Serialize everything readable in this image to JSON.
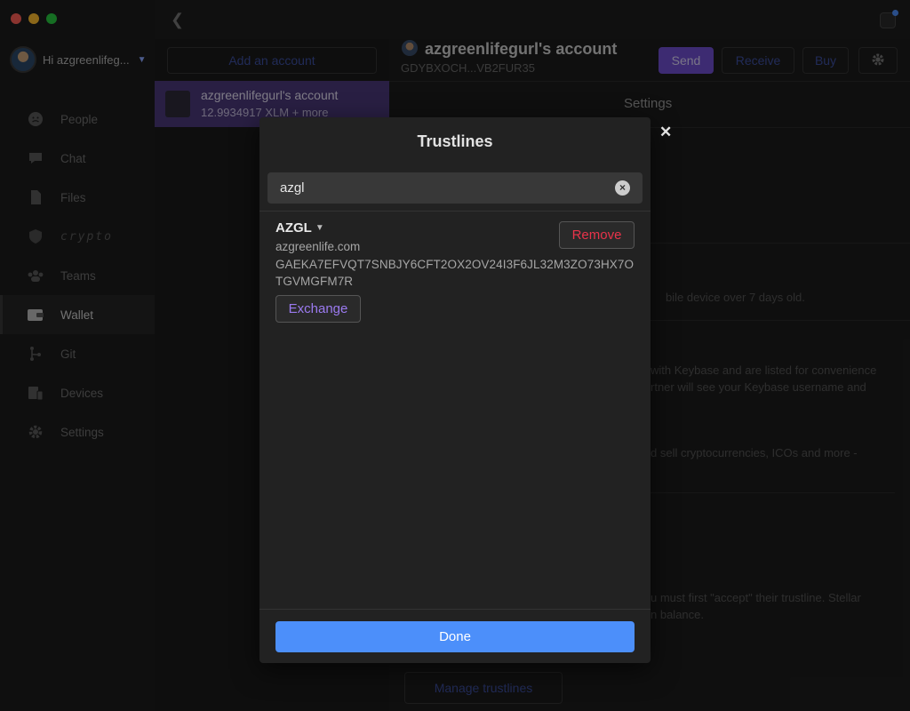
{
  "sidebar": {
    "greeting": "Hi azgreenlifeg...",
    "items": [
      {
        "label": "People",
        "icon": "people-icon"
      },
      {
        "label": "Chat",
        "icon": "chat-icon"
      },
      {
        "label": "Files",
        "icon": "files-icon"
      },
      {
        "label": "crypto",
        "icon": "crypto-shield-icon"
      },
      {
        "label": "Teams",
        "icon": "teams-icon"
      },
      {
        "label": "Wallet",
        "icon": "wallet-icon",
        "active": true
      },
      {
        "label": "Git",
        "icon": "git-icon"
      },
      {
        "label": "Devices",
        "icon": "devices-icon"
      },
      {
        "label": "Settings",
        "icon": "gear-icon"
      }
    ]
  },
  "accounts": {
    "add_label": "Add an account",
    "selected": {
      "name": "azgreenlifegurl's account",
      "balance": "12.9934917 XLM + more"
    }
  },
  "main": {
    "title": "azgreenlifegurl's account",
    "address": "GDYBXOCH...VB2FUR35",
    "buttons": {
      "send": "Send",
      "receive": "Receive",
      "buy": "Buy"
    },
    "settings_title": "Settings",
    "bg_texts": {
      "t1": "bile device over 7 days old.",
      "t2": "with Keybase and are listed for convenience",
      "t3": "rtner will see your Keybase username and",
      "t4": "d sell cryptocurrencies, ICOs and more -",
      "t5": "u must first \"accept\" their trustline. Stellar",
      "t6": "n balance."
    },
    "manage_label": "Manage trustlines"
  },
  "modal": {
    "title": "Trustlines",
    "search_value": "azgl",
    "asset": {
      "code": "AZGL",
      "domain": "azgreenlife.com",
      "issuer": "GAEKA7EFVQT7SNBJY6CFT2OX2OV24I3F6JL32M3ZO73HX7OTGVMGFM7R"
    },
    "remove_label": "Remove",
    "exchange_label": "Exchange",
    "done_label": "Done"
  },
  "colors": {
    "accent_purple": "#6f4fd0",
    "done_blue": "#4c8ffa",
    "remove_red": "#e8334a"
  }
}
